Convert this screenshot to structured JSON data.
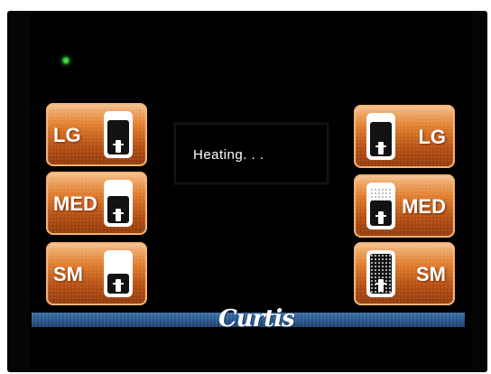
{
  "status": {
    "message": "Heating. . ."
  },
  "brand": {
    "name": "Curtis"
  },
  "indicator": {
    "color": "#2fd02f",
    "icon": "status-led-icon"
  },
  "left_buttons": [
    {
      "label": "LG",
      "icon": "cup-icon"
    },
    {
      "label": "MED",
      "icon": "cup-icon"
    },
    {
      "label": "SM",
      "icon": "cup-icon"
    }
  ],
  "right_buttons": [
    {
      "label": "LG",
      "icon": "cup-icon"
    },
    {
      "label": "MED",
      "icon": "cup-icon"
    },
    {
      "label": "SM",
      "icon": "cup-icon"
    }
  ],
  "colors": {
    "button_orange": "#e07d2c",
    "brand_bar_blue": "#26568d",
    "background": "#000000"
  }
}
